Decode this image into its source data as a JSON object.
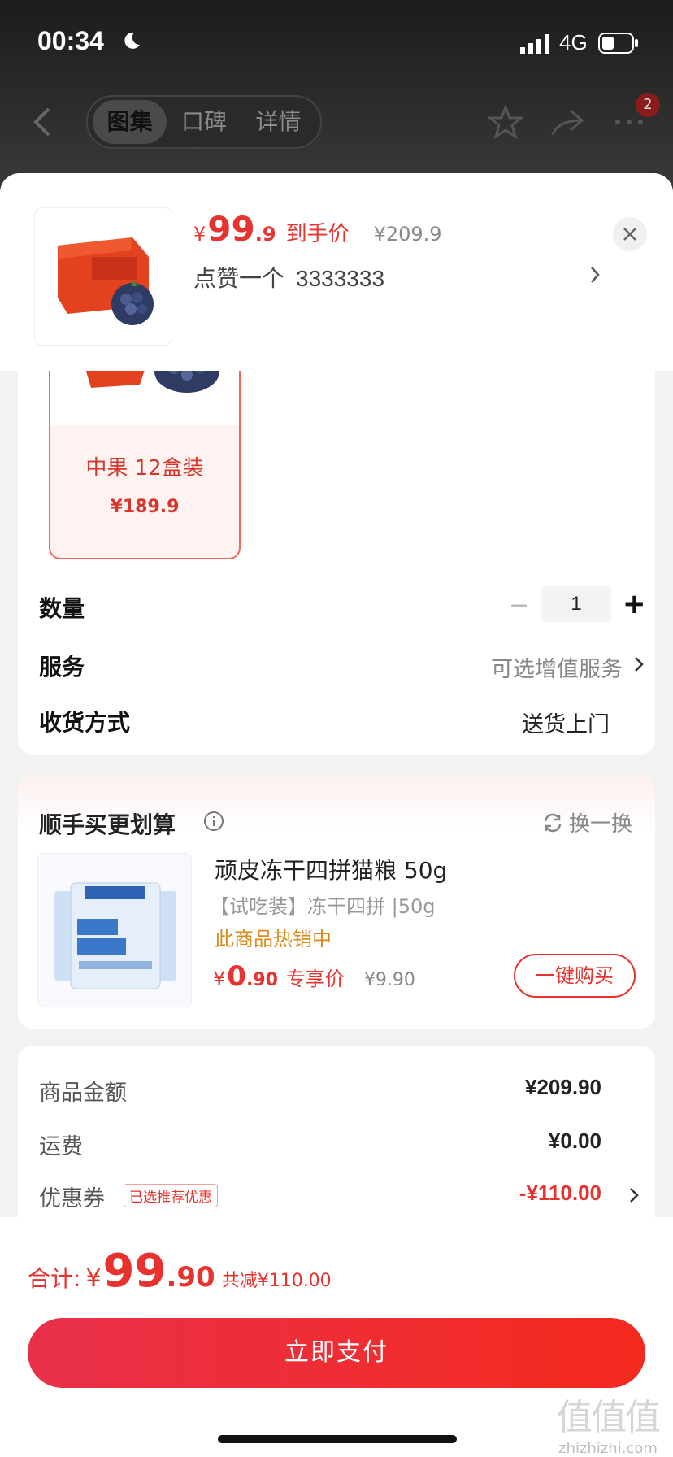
{
  "status_bar": {
    "time": "00:34",
    "network": "4G"
  },
  "top_nav": {
    "tabs": [
      "图集",
      "口碑",
      "详情"
    ],
    "active_tab": 0,
    "cart_badge": "2"
  },
  "sheet": {
    "price": {
      "currency": "¥",
      "integer": "99",
      "decimal": ".9",
      "tag": "到手价",
      "original": "¥209.9"
    },
    "spec": {
      "label": "点赞一个",
      "value": "3333333"
    },
    "variant": {
      "name": "中果 12盒装",
      "price": "¥189.9"
    },
    "rows": {
      "quantity": {
        "label": "数量",
        "value": "1",
        "minus": "−",
        "plus": "+"
      },
      "service": {
        "label": "服务",
        "value": "可选增值服务"
      },
      "delivery": {
        "label": "收货方式",
        "value": "送货上门"
      }
    }
  },
  "bundle": {
    "title": "顺手买更划算",
    "swap_label": "换一换",
    "product": {
      "name": "顽皮冻干四拼猫粮 50g",
      "spec": "【试吃装】冻干四拼 |50g",
      "hot": "此商品热销中",
      "price_currency": "¥",
      "price_integer": "0",
      "price_decimal": ".90",
      "price_tag": "专享价",
      "original": "¥9.90",
      "buy_label": "一键购买"
    }
  },
  "summary": {
    "goods": {
      "label": "商品金额",
      "value": "¥209.90"
    },
    "shipping": {
      "label": "运费",
      "value": "¥0.00"
    },
    "coupon": {
      "label": "优惠券",
      "tag": "已选推荐优惠",
      "value": "-¥110.00"
    }
  },
  "footer": {
    "total_label": "合计:",
    "currency": "¥",
    "integer": "99",
    "decimal": ".90",
    "saved": "共减¥110.00",
    "pay_label": "立即支付"
  },
  "watermark": {
    "glyphs": "值值值",
    "site": "zhizhizhi.com"
  },
  "colors": {
    "accent": "#e8322d",
    "hot": "#d98a1a"
  }
}
